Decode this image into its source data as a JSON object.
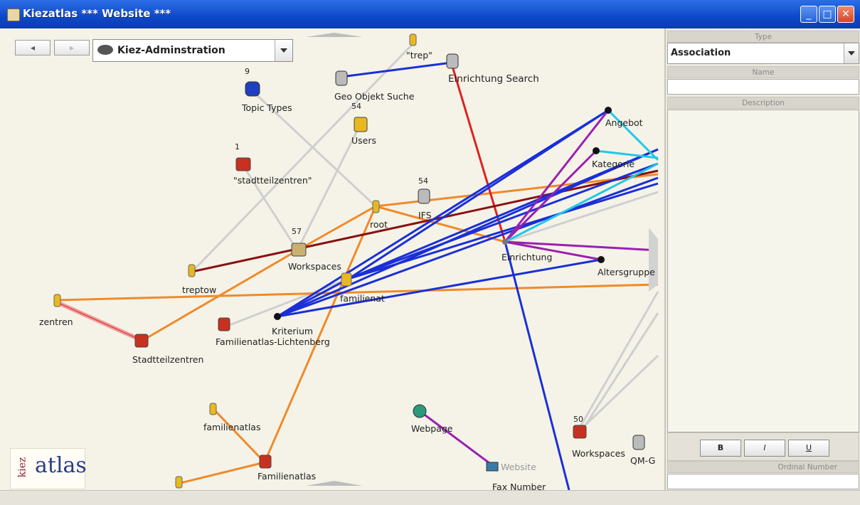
{
  "window": {
    "title": "Kiezatlas *** Website ***",
    "minimize": "_",
    "maximize": "□",
    "close": "✕"
  },
  "nav": {
    "back_label": "◂",
    "forward_label": "▸",
    "workspace": "Kiez-Adminstration"
  },
  "nodes": [
    {
      "id": "trep",
      "label": "\"trep\"",
      "icon": "user-icon"
    },
    {
      "id": "einrichtung_search",
      "label": "Einrichtung Search",
      "icon": "cylinder-icon"
    },
    {
      "id": "geo_objekt_suche",
      "label": "Geo Objekt Suche",
      "icon": "cylinder-icon"
    },
    {
      "id": "topic_types_count",
      "label": "9",
      "icon": ""
    },
    {
      "id": "topic_types",
      "label": "Topic Types",
      "icon": "topic-type-icon"
    },
    {
      "id": "users_count",
      "label": "54",
      "icon": ""
    },
    {
      "id": "users",
      "label": "Users",
      "icon": "users-icon"
    },
    {
      "id": "angebot",
      "label": "Angebot",
      "icon": "dot-icon"
    },
    {
      "id": "kategorie",
      "label": "Kategorie",
      "icon": "dot-icon"
    },
    {
      "id": "stadtteilzentren_q_count",
      "label": "1",
      "icon": ""
    },
    {
      "id": "stadtteilzentren_q",
      "label": "\"stadtteilzentren\"",
      "icon": "group-icon"
    },
    {
      "id": "ifs_count",
      "label": "54",
      "icon": ""
    },
    {
      "id": "ifs",
      "label": "IFS",
      "icon": "cylinder-icon"
    },
    {
      "id": "root",
      "label": "root",
      "icon": "user-icon"
    },
    {
      "id": "workspaces_count",
      "label": "57",
      "icon": ""
    },
    {
      "id": "workspaces",
      "label": "Workspaces",
      "icon": "workspace-icon"
    },
    {
      "id": "einrichtung",
      "label": "Einrichtung",
      "icon": "dot-icon"
    },
    {
      "id": "altersgruppe",
      "label": "Altersgruppe",
      "icon": "dot-icon"
    },
    {
      "id": "treptow",
      "label": "treptow",
      "icon": "user-icon"
    },
    {
      "id": "familienat",
      "label": "familienat",
      "icon": "user-icon"
    },
    {
      "id": "zentren",
      "label": "zentren",
      "icon": "user-icon"
    },
    {
      "id": "kriterium",
      "label": "Kriterium",
      "icon": "dot-icon"
    },
    {
      "id": "familienatlas_lichtenberg",
      "label": "Familienatlas-Lichtenberg",
      "icon": "workspace-icon"
    },
    {
      "id": "stadtteilzentren",
      "label": "Stadtteilzentren",
      "icon": "workspace-icon"
    },
    {
      "id": "familienatlas_user",
      "label": "familienatlas",
      "icon": "user-icon"
    },
    {
      "id": "webpage",
      "label": "Webpage",
      "icon": "globe-icon"
    },
    {
      "id": "workspaces2_count",
      "label": "50",
      "icon": ""
    },
    {
      "id": "workspaces2",
      "label": "Workspaces",
      "icon": "workspace-icon"
    },
    {
      "id": "qmg",
      "label": "QM-G",
      "icon": "cylinder-icon"
    },
    {
      "id": "website",
      "label": "Website",
      "icon": "fax-icon"
    },
    {
      "id": "familienatlas_ws",
      "label": "Familienatlas",
      "icon": "workspace-icon"
    },
    {
      "id": "fax_number",
      "label": "Fax Number",
      "icon": ""
    }
  ],
  "panel": {
    "type_header": "Type",
    "type_value": "Association",
    "name_header": "Name",
    "name_value": "",
    "description_header": "Description",
    "description_value": "",
    "format_buttons": [
      "B",
      "I",
      "U"
    ],
    "ordinal_header": "Ordinal Number",
    "ordinal_value": ""
  },
  "logo": {
    "kiez": "kiez",
    "atlas": "atlas"
  },
  "colors": {
    "titlebar": "#0e48c8",
    "canvas": "#f5f3e8",
    "blue_edge": "#1a2fd8",
    "orange_edge": "#f08a2a",
    "red_edge": "#e02020",
    "maroon_edge": "#8a1010",
    "purple_edge": "#9a20b0",
    "cyan_edge": "#20c8e8",
    "grey_edge": "#cfcfcf"
  }
}
